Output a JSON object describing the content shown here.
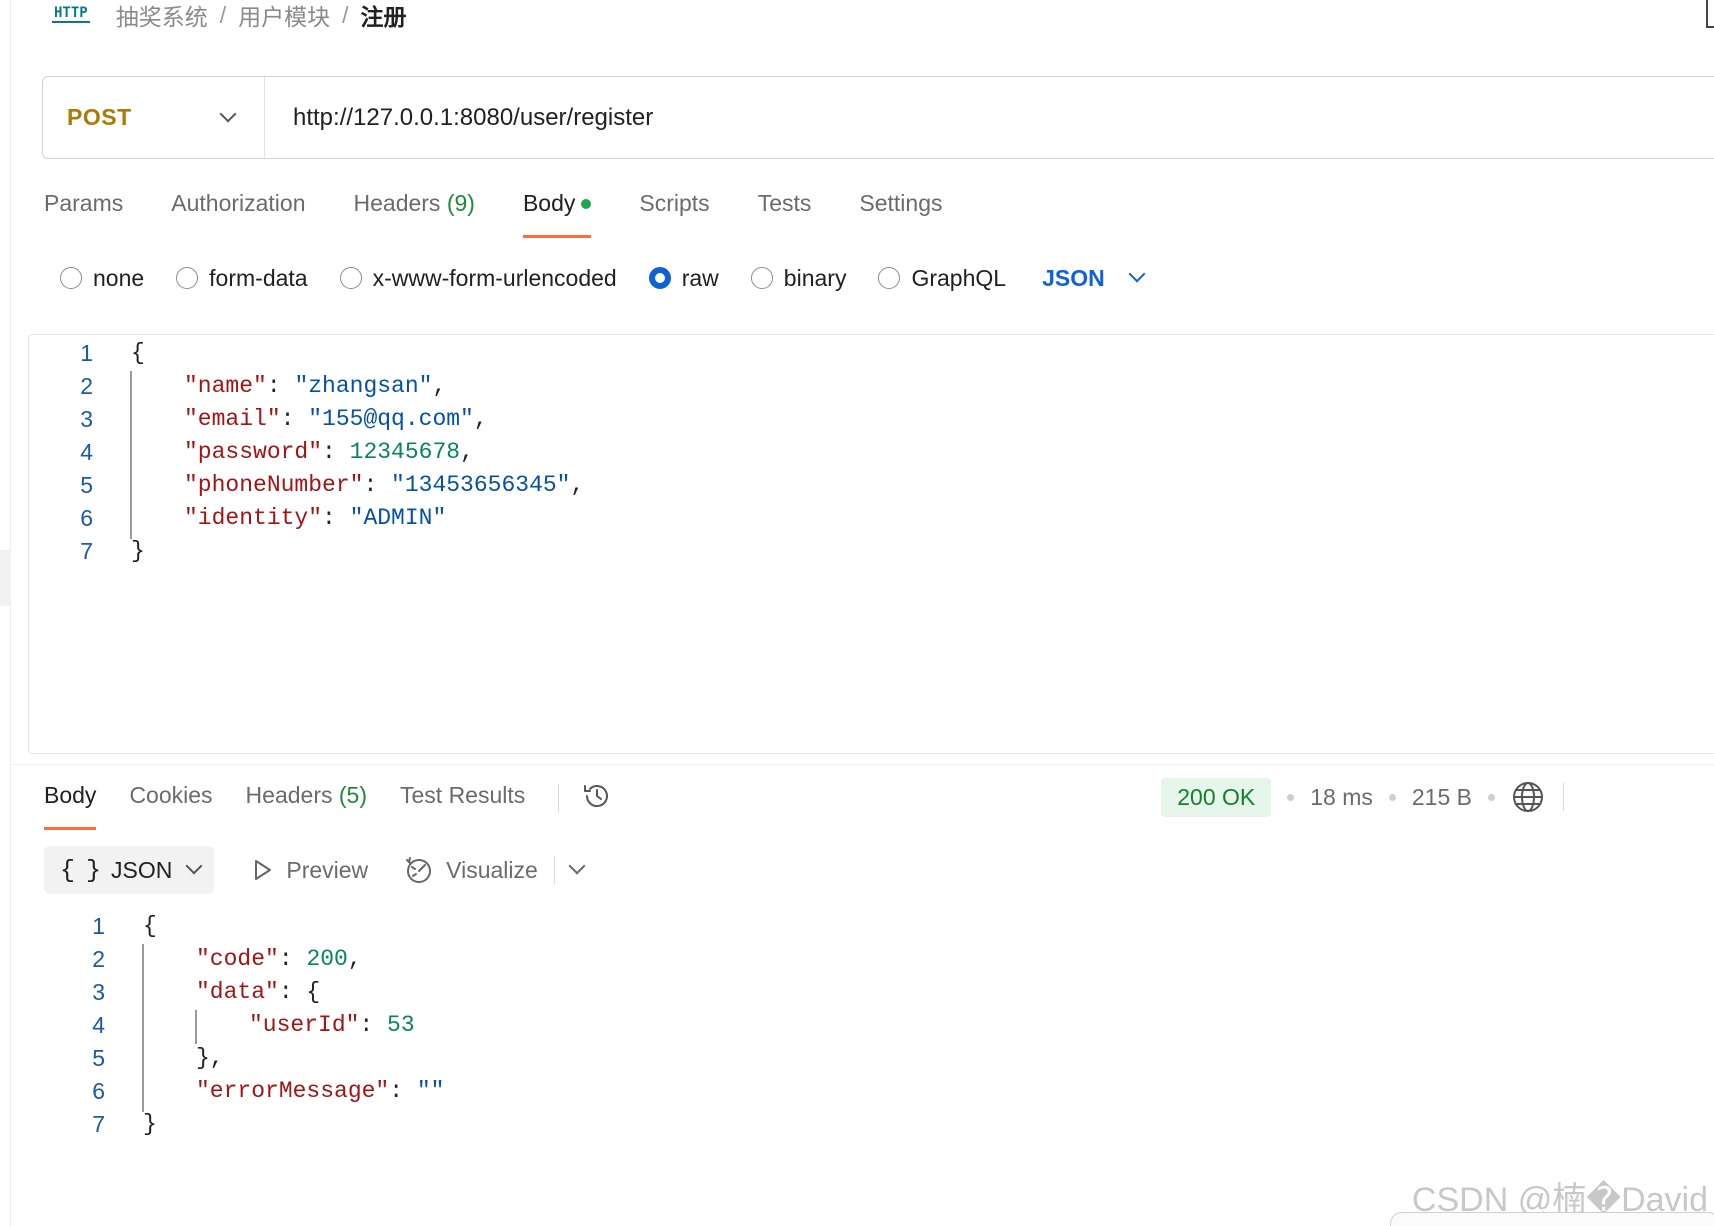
{
  "breadcrumb": {
    "badge": "HTTP",
    "items": [
      "抽奖系统",
      "用户模块",
      "注册"
    ],
    "separator": "/"
  },
  "request": {
    "method": "POST",
    "method_color": "#ad7a03",
    "url": "http://127.0.0.1:8080/user/register",
    "tabs": [
      {
        "label": "Params"
      },
      {
        "label": "Authorization"
      },
      {
        "label": "Headers",
        "count": "(9)"
      },
      {
        "label": "Body",
        "active": true,
        "indicator": "green-dot"
      },
      {
        "label": "Scripts"
      },
      {
        "label": "Tests"
      },
      {
        "label": "Settings"
      }
    ],
    "body_types": [
      {
        "label": "none",
        "checked": false
      },
      {
        "label": "form-data",
        "checked": false
      },
      {
        "label": "x-www-form-urlencoded",
        "checked": false
      },
      {
        "label": "raw",
        "checked": true
      },
      {
        "label": "binary",
        "checked": false
      },
      {
        "label": "GraphQL",
        "checked": false
      }
    ],
    "format": "JSON",
    "editor_lines": [
      {
        "n": "1",
        "tokens": [
          [
            "pun",
            "{"
          ]
        ]
      },
      {
        "n": "2",
        "tokens": [
          [
            "key",
            "\"name\""
          ],
          [
            "pun",
            ": "
          ],
          [
            "str",
            "\"zhangsan\""
          ],
          [
            "pun",
            ","
          ]
        ]
      },
      {
        "n": "3",
        "tokens": [
          [
            "key",
            "\"email\""
          ],
          [
            "pun",
            ": "
          ],
          [
            "str",
            "\"155@qq.com\""
          ],
          [
            "pun",
            ","
          ]
        ]
      },
      {
        "n": "4",
        "tokens": [
          [
            "key",
            "\"password\""
          ],
          [
            "pun",
            ": "
          ],
          [
            "num",
            "12345678"
          ],
          [
            "pun",
            ","
          ]
        ]
      },
      {
        "n": "5",
        "tokens": [
          [
            "key",
            "\"phoneNumber\""
          ],
          [
            "pun",
            ": "
          ],
          [
            "str",
            "\"13453656345\""
          ],
          [
            "pun",
            ","
          ]
        ]
      },
      {
        "n": "6",
        "tokens": [
          [
            "key",
            "\"identity\""
          ],
          [
            "pun",
            ": "
          ],
          [
            "str",
            "\"ADMIN\""
          ]
        ]
      },
      {
        "n": "7",
        "tokens": [
          [
            "pun",
            "}"
          ]
        ]
      }
    ]
  },
  "response": {
    "tabs": [
      {
        "label": "Body",
        "active": true
      },
      {
        "label": "Cookies"
      },
      {
        "label": "Headers",
        "count": "(5)"
      },
      {
        "label": "Test Results"
      }
    ],
    "status": "200 OK",
    "time": "18 ms",
    "size": "215 B",
    "status_color": "#14802e",
    "format": "JSON",
    "format_braces": "{ }",
    "preview_label": "Preview",
    "visualize_label": "Visualize",
    "viewer_lines": [
      {
        "n": "1",
        "indent": 0,
        "tokens": [
          [
            "pun",
            "{"
          ]
        ]
      },
      {
        "n": "2",
        "indent": 1,
        "tokens": [
          [
            "key",
            "\"code\""
          ],
          [
            "pun",
            ": "
          ],
          [
            "num",
            "200"
          ],
          [
            "pun",
            ","
          ]
        ]
      },
      {
        "n": "3",
        "indent": 1,
        "tokens": [
          [
            "key",
            "\"data\""
          ],
          [
            "pun",
            ": {"
          ]
        ]
      },
      {
        "n": "4",
        "indent": 2,
        "tokens": [
          [
            "key",
            "\"userId\""
          ],
          [
            "pun",
            ": "
          ],
          [
            "num",
            "53"
          ]
        ]
      },
      {
        "n": "5",
        "indent": 1,
        "tokens": [
          [
            "pun",
            "},"
          ]
        ]
      },
      {
        "n": "6",
        "indent": 1,
        "tokens": [
          [
            "key",
            "\"errorMessage\""
          ],
          [
            "pun",
            ": "
          ],
          [
            "str",
            "\"\""
          ]
        ]
      },
      {
        "n": "7",
        "indent": 0,
        "tokens": [
          [
            "pun",
            "}"
          ]
        ]
      }
    ]
  },
  "watermark": "CSDN @楠�David",
  "icons": {
    "history": "history-icon",
    "globe": "globe-icon",
    "preview": "play-icon",
    "visualize": "visualize-icon"
  }
}
